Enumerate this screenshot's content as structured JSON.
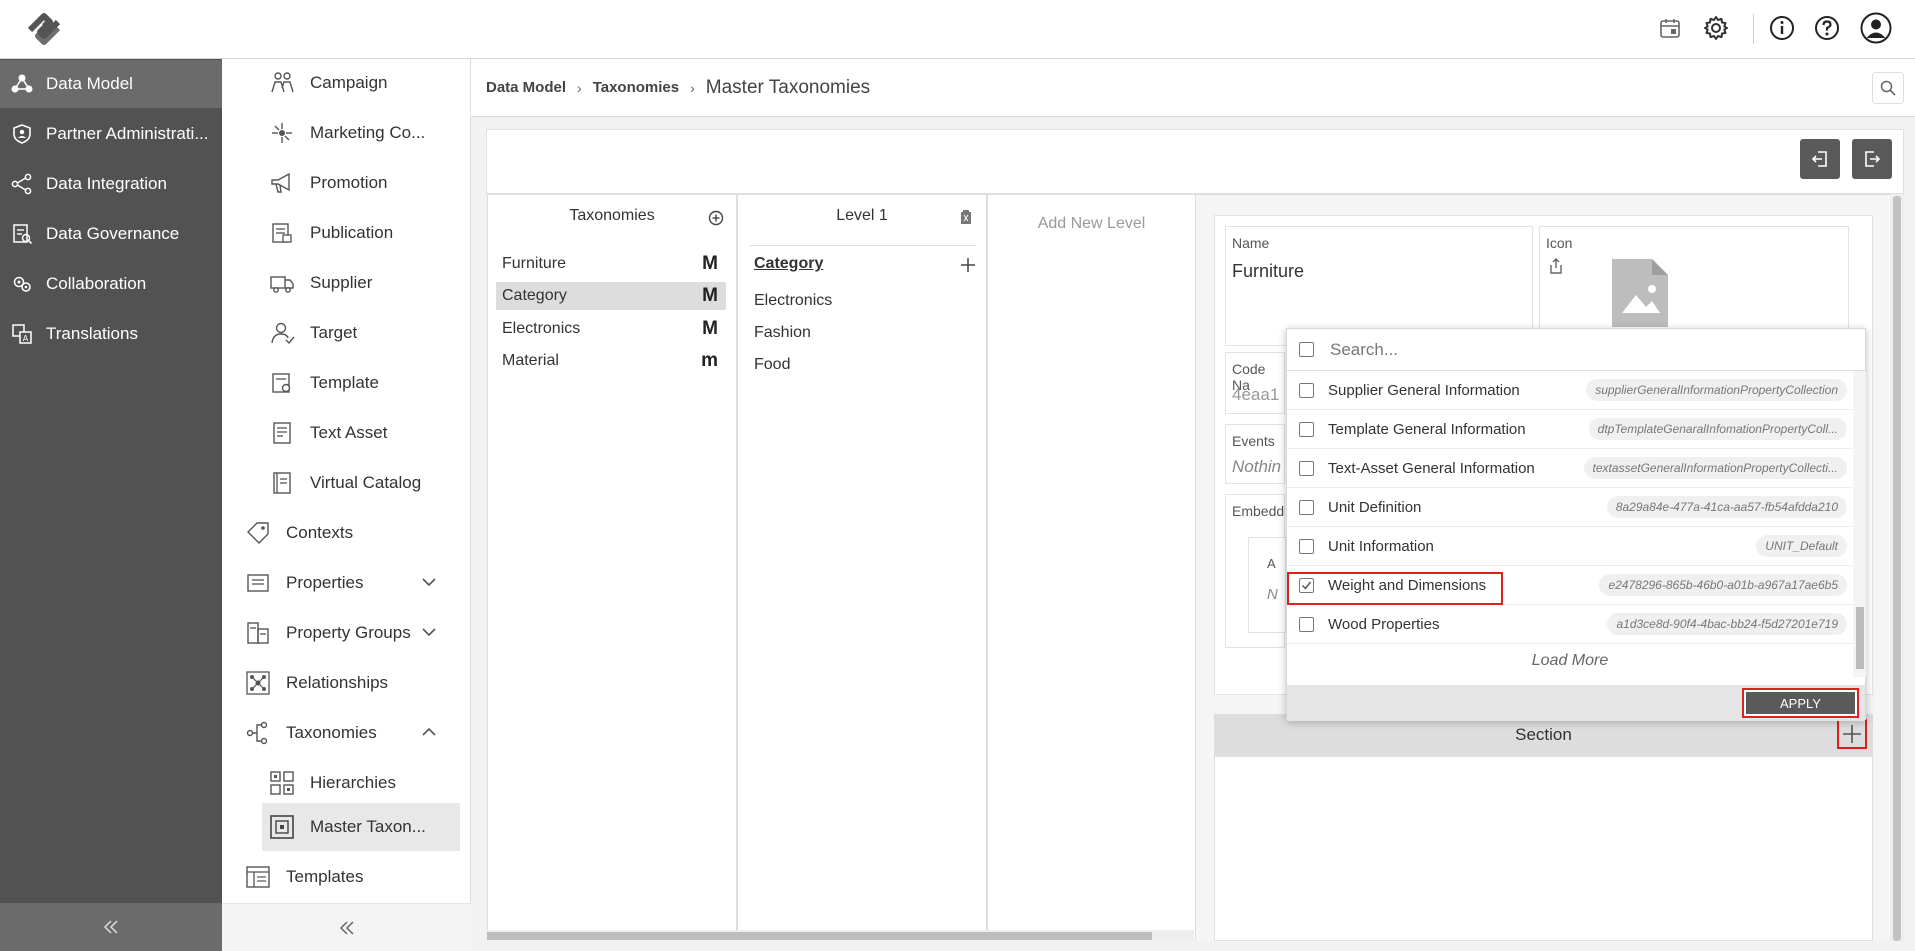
{
  "sidebar": {
    "items": [
      {
        "label": "Data Model",
        "icon": "data-model-icon",
        "active": true
      },
      {
        "label": "Partner Administrati...",
        "icon": "shield-icon"
      },
      {
        "label": "Data Integration",
        "icon": "integration-icon"
      },
      {
        "label": "Data Governance",
        "icon": "governance-icon"
      },
      {
        "label": "Collaboration",
        "icon": "collaboration-icon"
      },
      {
        "label": "Translations",
        "icon": "translations-icon"
      }
    ],
    "collapse_icon": "double-chevron-left-icon"
  },
  "subnav": {
    "items": [
      {
        "label": "Campaign"
      },
      {
        "label": "Marketing Co..."
      },
      {
        "label": "Promotion"
      },
      {
        "label": "Publication"
      },
      {
        "label": "Supplier"
      },
      {
        "label": "Target"
      },
      {
        "label": "Template"
      },
      {
        "label": "Text Asset"
      },
      {
        "label": "Virtual Catalog"
      },
      {
        "label": "Contexts"
      },
      {
        "label": "Properties"
      },
      {
        "label": "Property Groups"
      },
      {
        "label": "Relationships"
      },
      {
        "label": "Taxonomies"
      },
      {
        "label": "Hierarchies"
      },
      {
        "label": "Master Taxon..."
      },
      {
        "label": "Templates"
      }
    ]
  },
  "breadcrumb": {
    "items": [
      "Data Model",
      "Taxonomies"
    ],
    "current": "Master Taxonomies",
    "separator": "›"
  },
  "taxonomies": {
    "header": "Taxonomies",
    "items": [
      {
        "label": "Furniture",
        "badge": "M"
      },
      {
        "label": "Category",
        "badge": "M",
        "selected": true
      },
      {
        "label": "Electronics",
        "badge": "M"
      },
      {
        "label": "Material",
        "badge": "m"
      }
    ]
  },
  "level1": {
    "header": "Level 1",
    "category": "Category",
    "items": [
      "Electronics",
      "Fashion",
      "Food"
    ]
  },
  "add_level": {
    "label": "Add New Level"
  },
  "detail": {
    "name_label": "Name",
    "name_value": "Furniture",
    "icon_label": "Icon",
    "code_label": "Code Na",
    "code_value": "4eaa1",
    "events_label": "Events",
    "events_value": "Nothin",
    "embedded_label": "Embedd",
    "inner_label": "A",
    "inner_value": "N",
    "section_label": "Section"
  },
  "dropdown": {
    "search_placeholder": "Search...",
    "rows": [
      {
        "name": "Supplier General Information",
        "code": "supplierGeneralInformationPropertyCollection",
        "checked": false
      },
      {
        "name": "Template General Information",
        "code": "dtpTemplateGenaralInfomationPropertyColl...",
        "checked": false
      },
      {
        "name": "Text-Asset General Information",
        "code": "textassetGeneralInformationPropertyCollecti...",
        "checked": false
      },
      {
        "name": "Unit Definition",
        "code": "8a29a84e-477a-41ca-aa57-fb54afdda210",
        "checked": false
      },
      {
        "name": "Unit Information",
        "code": "UNIT_Default",
        "checked": false
      },
      {
        "name": "Weight and Dimensions",
        "code": "e2478296-865b-46b0-a01b-a967a17ae6b5",
        "checked": true
      },
      {
        "name": "Wood Properties",
        "code": "a1d3ce8d-90f4-4bac-bb24-f5d27201e719",
        "checked": false
      }
    ],
    "load_more": "Load More",
    "apply_label": "APPLY"
  },
  "colors": {
    "nav_bg": "#525252",
    "nav_active": "#6b6b6b",
    "highlight": "#e02020",
    "button_dark": "#5a5a5a"
  }
}
